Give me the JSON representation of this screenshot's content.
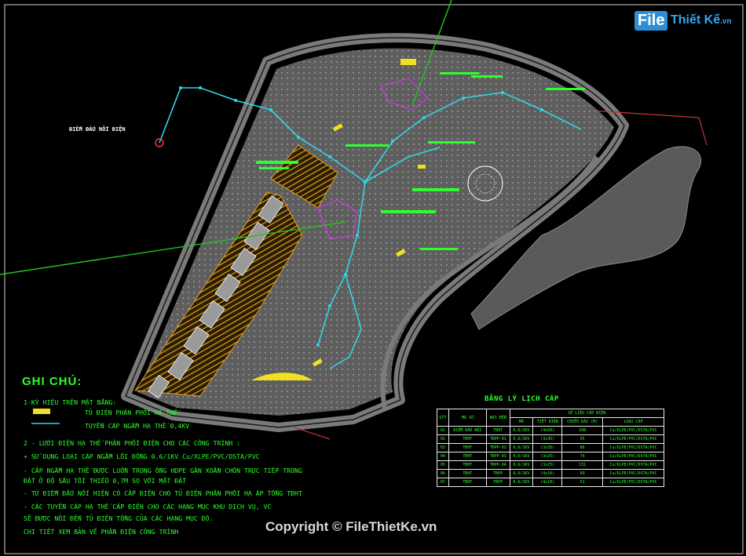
{
  "logo": {
    "brand_box": "File",
    "brand_rest": "Thiết Kế",
    "brand_tld": ".vn"
  },
  "map": {
    "start_point_label": "ĐIỂM ĐẤU NỐI ĐIỆN",
    "colors": {
      "road": "#4a4a4a",
      "site": "#5e5e5e",
      "hatch": "#e8a11a",
      "cable": "#31d6e6",
      "feeder": "#c23dd6",
      "grid_line": "#22c41d",
      "boundary": "#c3343a",
      "label": "#2cff2c"
    }
  },
  "notes": {
    "title": "GHI CHÚ:",
    "lines": [
      "1-KÝ HIỆU TRÊN MẶT BẰNG:",
      "TỦ ĐIỆN PHÂN PHỐI HẠ THẾ",
      "TUYẾN CÁP NGẦM HẠ THẾ  0,4KV",
      "2 - LƯỚI ĐIỆN HẠ THẾ PHÂN PHỐI ĐIỆN CHO CÁC CÔNG TRÌNH :",
      "+ SỬ DỤNG LOẠI CÁP NGẦM LÕI ĐỒNG 0.6/1KV Cu/XLPE/PVC/DSTA/PVC",
      "- CÁP NGẦM HẠ THẾ ĐƯỢC LUỒN TRONG ỐNG HDPE GÂN XOẮN CHÔN TRỰC TIẾP TRONG",
      "ĐẤT Ở ĐỘ SÂU TỐI THIỂU 0,7M SO VỚI MẶT ĐẤT",
      "- TỪ ĐIỂM ĐẤU NỐI HIỆN CÓ CẤP ĐIỆN CHO TỦ ĐIỆN PHÂN PHỐI HẠ ÁP TỔNG TĐHT",
      "- CÁC TUYẾN CÁP HẠ THẾ CẤP ĐIỆN CHO CÁC HẠNG MỤC KHU DỊCH VỤ, VC",
      "SẼ ĐƯỢC NỐI ĐẾN TỦ ĐIỆN TỔNG CỦA CÁC HẠNG MỤC ĐÓ.",
      "CHI TIẾT XEM BẢN VẼ PHẦN ĐIỆN CÔNG TRÌNH"
    ]
  },
  "cable_table": {
    "title": "BẢNG LÝ LỊCH CÁP",
    "headers": [
      "STT",
      "MÃ SỐ",
      "NƠI ĐẾN",
      "SỐ LIỆU CÁP ĐIỆN",
      "MÃ",
      "TIẾT DIỆN",
      "CHIỀU DÀI (M)",
      "LOẠI CÁP"
    ],
    "rows": [
      [
        "01",
        "ĐIỂM ĐẤU NỐI",
        "TĐHT",
        "0,6/1KV",
        "(4x50)",
        "108",
        "Cu/XLPE/PVC/DSTA/PVC"
      ],
      [
        "02",
        "TĐHT",
        "TĐPP-01",
        "0,6/1KV",
        "(3x35)",
        "55",
        "Cu/XLPE/PVC/DSTA/PVC"
      ],
      [
        "03",
        "TĐHT",
        "TĐPP-02",
        "0,6/1KV",
        "(3x35)",
        "86",
        "Cu/XLPE/PVC/DSTA/PVC"
      ],
      [
        "04",
        "TĐHT",
        "TĐPP-03",
        "0,6/1KV",
        "(3x25)",
        "74",
        "Cu/XLPE/PVC/DSTA/PVC"
      ],
      [
        "05",
        "TĐHT",
        "TĐPP-04",
        "0,6/1KV",
        "(3x25)",
        "131",
        "Cu/XLPE/PVC/DSTA/PVC"
      ],
      [
        "06",
        "TĐHT",
        "TĐPP",
        "0,6/1KV",
        "(4x16)",
        "69",
        "Cu/XLPE/PVC/DSTA/PVC"
      ],
      [
        "07",
        "TĐHT",
        "TĐPP",
        "0,6/1KV",
        "(4x10)",
        "51",
        "Cu/XLPE/PVC/DSTA/PVC"
      ]
    ]
  },
  "copyright": "Copyright © FileThietKe.vn"
}
